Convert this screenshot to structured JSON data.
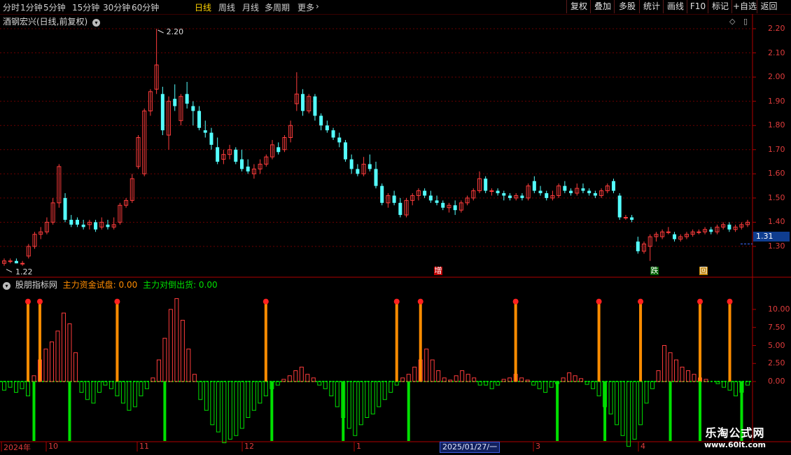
{
  "toolbar": {
    "periods": [
      "分时",
      "1分钟",
      "5分钟",
      "15分钟",
      "30分钟",
      "60分钟",
      "日线",
      "周线",
      "月线",
      "多周期",
      "更多"
    ],
    "active_period": "日线",
    "right_buttons": [
      "复权",
      "叠加",
      "多股",
      "统计",
      "画线",
      "F10",
      "标记",
      "+自选",
      "返回"
    ]
  },
  "main_chart": {
    "title": "酒钢宏兴(日线,前复权)",
    "high_label": "2.20",
    "low_label": "1.22",
    "current_price": "1.31",
    "signal_labels": [
      "增",
      "跌",
      "回"
    ]
  },
  "indicator": {
    "name": "股朋指标网",
    "series1_label": "主力资金试盘: 0.00",
    "series2_label": "主力对倒出货: 0.00"
  },
  "x_axis": {
    "labels": [
      "2024年",
      "10",
      "11",
      "12",
      "1",
      "2025/01/27/一",
      "3",
      "4"
    ]
  },
  "watermark": {
    "cn": "乐淘公式网",
    "url": "www.60lt.com"
  },
  "colors": {
    "up": "#ff3c3c",
    "down": "#54ffff",
    "test": "#ff8c00",
    "dump": "#00e000",
    "axis": "#b00000"
  },
  "chart_data": [
    {
      "type": "candlestick",
      "title": "酒钢宏兴(日线,前复权)",
      "ylim": [
        1.18,
        2.24
      ],
      "y_ticks": [
        "2.20",
        "2.10",
        "2.00",
        "1.90",
        "1.80",
        "1.70",
        "1.60",
        "1.50",
        "1.40",
        "1.30"
      ],
      "x_ticks": [
        "2024年",
        "10",
        "11",
        "12",
        "1",
        "2025/01/27/一",
        "3",
        "4"
      ],
      "ohlc": [
        [
          1.23,
          1.25,
          1.22,
          1.24
        ],
        [
          1.24,
          1.25,
          1.23,
          1.24
        ],
        [
          1.24,
          1.25,
          1.23,
          1.23
        ],
        [
          1.23,
          1.24,
          1.22,
          1.23
        ],
        [
          1.26,
          1.31,
          1.25,
          1.3
        ],
        [
          1.3,
          1.36,
          1.29,
          1.35
        ],
        [
          1.35,
          1.38,
          1.33,
          1.36
        ],
        [
          1.36,
          1.42,
          1.35,
          1.4
        ],
        [
          1.4,
          1.5,
          1.39,
          1.48
        ],
        [
          1.48,
          1.64,
          1.46,
          1.63
        ],
        [
          1.5,
          1.52,
          1.4,
          1.41
        ],
        [
          1.41,
          1.43,
          1.38,
          1.39
        ],
        [
          1.41,
          1.42,
          1.38,
          1.39
        ],
        [
          1.39,
          1.41,
          1.37,
          1.38
        ],
        [
          1.39,
          1.41,
          1.37,
          1.4
        ],
        [
          1.4,
          1.41,
          1.36,
          1.37
        ],
        [
          1.38,
          1.42,
          1.37,
          1.4
        ],
        [
          1.39,
          1.41,
          1.37,
          1.38
        ],
        [
          1.38,
          1.42,
          1.37,
          1.39
        ],
        [
          1.4,
          1.48,
          1.39,
          1.47
        ],
        [
          1.47,
          1.5,
          1.46,
          1.49
        ],
        [
          1.49,
          1.6,
          1.48,
          1.58
        ],
        [
          1.63,
          1.76,
          1.62,
          1.75
        ],
        [
          1.6,
          1.87,
          1.59,
          1.86
        ],
        [
          1.86,
          1.95,
          1.84,
          1.94
        ],
        [
          1.95,
          2.2,
          1.93,
          2.05
        ],
        [
          1.93,
          1.96,
          1.76,
          1.78
        ],
        [
          1.76,
          1.92,
          1.7,
          1.9
        ],
        [
          1.91,
          1.97,
          1.86,
          1.88
        ],
        [
          1.82,
          1.93,
          1.8,
          1.92
        ],
        [
          1.93,
          1.98,
          1.87,
          1.89
        ],
        [
          1.88,
          1.9,
          1.8,
          1.86
        ],
        [
          1.86,
          1.88,
          1.78,
          1.79
        ],
        [
          1.78,
          1.82,
          1.75,
          1.77
        ],
        [
          1.77,
          1.79,
          1.7,
          1.72
        ],
        [
          1.71,
          1.75,
          1.64,
          1.65
        ],
        [
          1.66,
          1.7,
          1.64,
          1.68
        ],
        [
          1.68,
          1.72,
          1.66,
          1.7
        ],
        [
          1.7,
          1.71,
          1.64,
          1.65
        ],
        [
          1.66,
          1.7,
          1.61,
          1.62
        ],
        [
          1.63,
          1.66,
          1.6,
          1.61
        ],
        [
          1.6,
          1.64,
          1.58,
          1.62
        ],
        [
          1.62,
          1.66,
          1.6,
          1.64
        ],
        [
          1.64,
          1.68,
          1.63,
          1.67
        ],
        [
          1.67,
          1.74,
          1.66,
          1.72
        ],
        [
          1.71,
          1.73,
          1.68,
          1.69
        ],
        [
          1.7,
          1.76,
          1.69,
          1.75
        ],
        [
          1.75,
          1.82,
          1.73,
          1.8
        ],
        [
          1.89,
          2.02,
          1.86,
          1.93
        ],
        [
          1.93,
          1.95,
          1.84,
          1.86
        ],
        [
          1.86,
          1.93,
          1.85,
          1.92
        ],
        [
          1.92,
          1.93,
          1.82,
          1.84
        ],
        [
          1.84,
          1.85,
          1.78,
          1.8
        ],
        [
          1.8,
          1.82,
          1.77,
          1.78
        ],
        [
          1.78,
          1.79,
          1.74,
          1.75
        ],
        [
          1.75,
          1.77,
          1.71,
          1.73
        ],
        [
          1.73,
          1.74,
          1.65,
          1.66
        ],
        [
          1.66,
          1.68,
          1.6,
          1.62
        ],
        [
          1.62,
          1.64,
          1.59,
          1.6
        ],
        [
          1.6,
          1.67,
          1.59,
          1.64
        ],
        [
          1.64,
          1.68,
          1.61,
          1.62
        ],
        [
          1.62,
          1.65,
          1.54,
          1.55
        ],
        [
          1.55,
          1.56,
          1.47,
          1.48
        ],
        [
          1.48,
          1.52,
          1.46,
          1.51
        ],
        [
          1.51,
          1.53,
          1.47,
          1.48
        ],
        [
          1.48,
          1.5,
          1.42,
          1.43
        ],
        [
          1.43,
          1.5,
          1.42,
          1.49
        ],
        [
          1.49,
          1.52,
          1.47,
          1.51
        ],
        [
          1.51,
          1.54,
          1.49,
          1.53
        ],
        [
          1.53,
          1.54,
          1.5,
          1.51
        ],
        [
          1.51,
          1.53,
          1.48,
          1.49
        ],
        [
          1.49,
          1.51,
          1.47,
          1.48
        ],
        [
          1.48,
          1.49,
          1.45,
          1.46
        ],
        [
          1.46,
          1.48,
          1.44,
          1.47
        ],
        [
          1.47,
          1.49,
          1.43,
          1.45
        ],
        [
          1.45,
          1.49,
          1.44,
          1.48
        ],
        [
          1.48,
          1.51,
          1.47,
          1.5
        ],
        [
          1.5,
          1.54,
          1.49,
          1.53
        ],
        [
          1.53,
          1.61,
          1.52,
          1.58
        ],
        [
          1.58,
          1.59,
          1.52,
          1.53
        ],
        [
          1.53,
          1.54,
          1.51,
          1.53
        ],
        [
          1.53,
          1.54,
          1.51,
          1.52
        ],
        [
          1.52,
          1.53,
          1.49,
          1.51
        ],
        [
          1.51,
          1.52,
          1.49,
          1.5
        ],
        [
          1.5,
          1.52,
          1.49,
          1.51
        ],
        [
          1.51,
          1.52,
          1.49,
          1.5
        ],
        [
          1.5,
          1.56,
          1.49,
          1.55
        ],
        [
          1.57,
          1.59,
          1.52,
          1.53
        ],
        [
          1.53,
          1.55,
          1.51,
          1.52
        ],
        [
          1.52,
          1.53,
          1.49,
          1.5
        ],
        [
          1.5,
          1.53,
          1.49,
          1.51
        ],
        [
          1.51,
          1.56,
          1.5,
          1.55
        ],
        [
          1.55,
          1.57,
          1.52,
          1.53
        ],
        [
          1.53,
          1.54,
          1.51,
          1.52
        ],
        [
          1.52,
          1.56,
          1.51,
          1.54
        ],
        [
          1.54,
          1.56,
          1.52,
          1.53
        ],
        [
          1.53,
          1.54,
          1.51,
          1.52
        ],
        [
          1.52,
          1.53,
          1.5,
          1.51
        ],
        [
          1.51,
          1.54,
          1.5,
          1.53
        ],
        [
          1.53,
          1.56,
          1.52,
          1.55
        ],
        [
          1.57,
          1.58,
          1.52,
          1.53
        ],
        [
          1.51,
          1.52,
          1.41,
          1.42
        ],
        [
          1.42,
          1.43,
          1.41,
          1.42
        ],
        [
          1.42,
          1.43,
          1.4,
          1.41
        ],
        [
          1.32,
          1.34,
          1.27,
          1.28
        ],
        [
          1.28,
          1.32,
          1.27,
          1.31
        ],
        [
          1.3,
          1.35,
          1.24,
          1.34
        ],
        [
          1.34,
          1.36,
          1.32,
          1.35
        ],
        [
          1.34,
          1.37,
          1.33,
          1.36
        ],
        [
          1.36,
          1.38,
          1.35,
          1.36
        ],
        [
          1.35,
          1.36,
          1.32,
          1.33
        ],
        [
          1.33,
          1.35,
          1.32,
          1.34
        ],
        [
          1.34,
          1.36,
          1.33,
          1.35
        ],
        [
          1.35,
          1.37,
          1.34,
          1.36
        ],
        [
          1.36,
          1.37,
          1.35,
          1.36
        ],
        [
          1.36,
          1.38,
          1.35,
          1.37
        ],
        [
          1.37,
          1.38,
          1.35,
          1.36
        ],
        [
          1.36,
          1.39,
          1.35,
          1.38
        ],
        [
          1.38,
          1.4,
          1.37,
          1.39
        ],
        [
          1.39,
          1.4,
          1.36,
          1.37
        ],
        [
          1.37,
          1.39,
          1.36,
          1.38
        ],
        [
          1.38,
          1.4,
          1.37,
          1.39
        ],
        [
          1.39,
          1.41,
          1.38,
          1.4
        ]
      ]
    },
    {
      "type": "bar",
      "title": "股朋指标网",
      "ylim": [
        -12,
        14
      ],
      "y_ticks": [
        "10.00",
        "7.50",
        "5.00",
        "2.50",
        "0.00"
      ],
      "series": [
        {
          "name": "主力资金试盘",
          "values": [
            -1.2,
            -0.8,
            -1.5,
            -1.0,
            -2.0,
            0.8,
            3.0,
            4.5,
            5.5,
            7.0,
            9.5,
            8.0,
            4.0,
            -1.5,
            -2.5,
            -3.0,
            -1.5,
            -0.5,
            -1.0,
            -2.0,
            -3.0,
            -4.0,
            -3.5,
            -2.0,
            -1.0,
            0.5,
            3.0,
            6.0,
            10.0,
            11.5,
            8.5,
            4.5,
            1.0,
            -2.5,
            -4.0,
            -6.0,
            -7.0,
            -8.5,
            -8.0,
            -7.5,
            -6.5,
            -5.0,
            -4.0,
            -3.0,
            -2.0,
            -1.0,
            -0.5,
            0.3,
            0.8,
            1.5,
            2.0,
            1.0,
            0.5,
            -0.5,
            -1.0,
            -2.0,
            -3.5,
            -5.0,
            -6.5,
            -7.5,
            -6.0,
            -5.0,
            -4.5,
            -3.5,
            -2.5,
            -1.5,
            -0.5,
            0.5,
            1.0,
            2.0,
            3.0,
            4.5,
            3.0,
            1.5,
            0.5,
            0.2,
            0.8,
            1.5,
            1.0,
            0.5,
            -0.5,
            -0.5,
            -1.0,
            -0.5,
            0.3,
            0.5,
            1.0,
            0.5,
            0.2,
            -0.5,
            -1.0,
            -1.5,
            -0.8,
            -0.3,
            0.5,
            1.2,
            0.8,
            0.4,
            -0.4,
            -1.0,
            -2.0,
            -3.5,
            -4.5,
            -6.0,
            -7.5,
            -9.0,
            -8.0,
            -6.0,
            -3.0,
            -1.0,
            1.5,
            5.0,
            4.0,
            3.0,
            2.0,
            1.5,
            1.0,
            0.5,
            0.3,
            0.0,
            -0.3,
            -0.8,
            -1.2,
            -2.0,
            -1.5,
            -0.5
          ]
        },
        {
          "name": "主力对倒出货",
          "values": [
            0,
            0,
            0,
            0,
            0,
            0,
            0,
            0,
            0,
            0,
            0,
            0,
            0,
            0,
            0,
            0,
            0,
            0,
            0,
            0,
            0,
            0,
            0,
            0,
            0,
            0,
            0,
            0,
            0,
            0,
            0,
            0,
            0,
            0,
            0,
            0,
            0,
            0,
            0,
            0,
            0,
            0,
            0,
            0,
            0,
            0,
            0,
            0,
            0,
            0,
            0,
            0,
            0,
            0,
            0,
            0,
            0,
            0,
            0,
            0,
            0,
            0,
            0,
            0,
            0,
            0,
            0,
            0,
            0,
            0,
            0,
            0,
            0,
            0,
            0,
            0,
            0,
            0,
            0,
            0,
            0,
            0,
            0,
            0,
            0,
            0,
            0,
            0,
            0,
            0,
            0,
            0,
            0,
            0,
            0,
            0,
            0,
            0,
            0,
            0,
            0,
            0,
            0,
            0,
            0,
            0,
            0,
            0,
            0,
            0,
            0,
            0,
            0,
            0,
            0,
            0,
            0,
            0,
            0,
            0,
            0,
            0,
            0,
            0,
            0
          ]
        }
      ],
      "test_signal_bars": [
        4,
        6,
        19,
        44,
        66,
        70,
        86,
        100,
        107,
        117,
        122
      ],
      "dump_signal_bars": [
        5,
        11,
        27,
        45,
        57,
        68,
        93,
        101,
        112,
        124,
        117
      ]
    }
  ]
}
